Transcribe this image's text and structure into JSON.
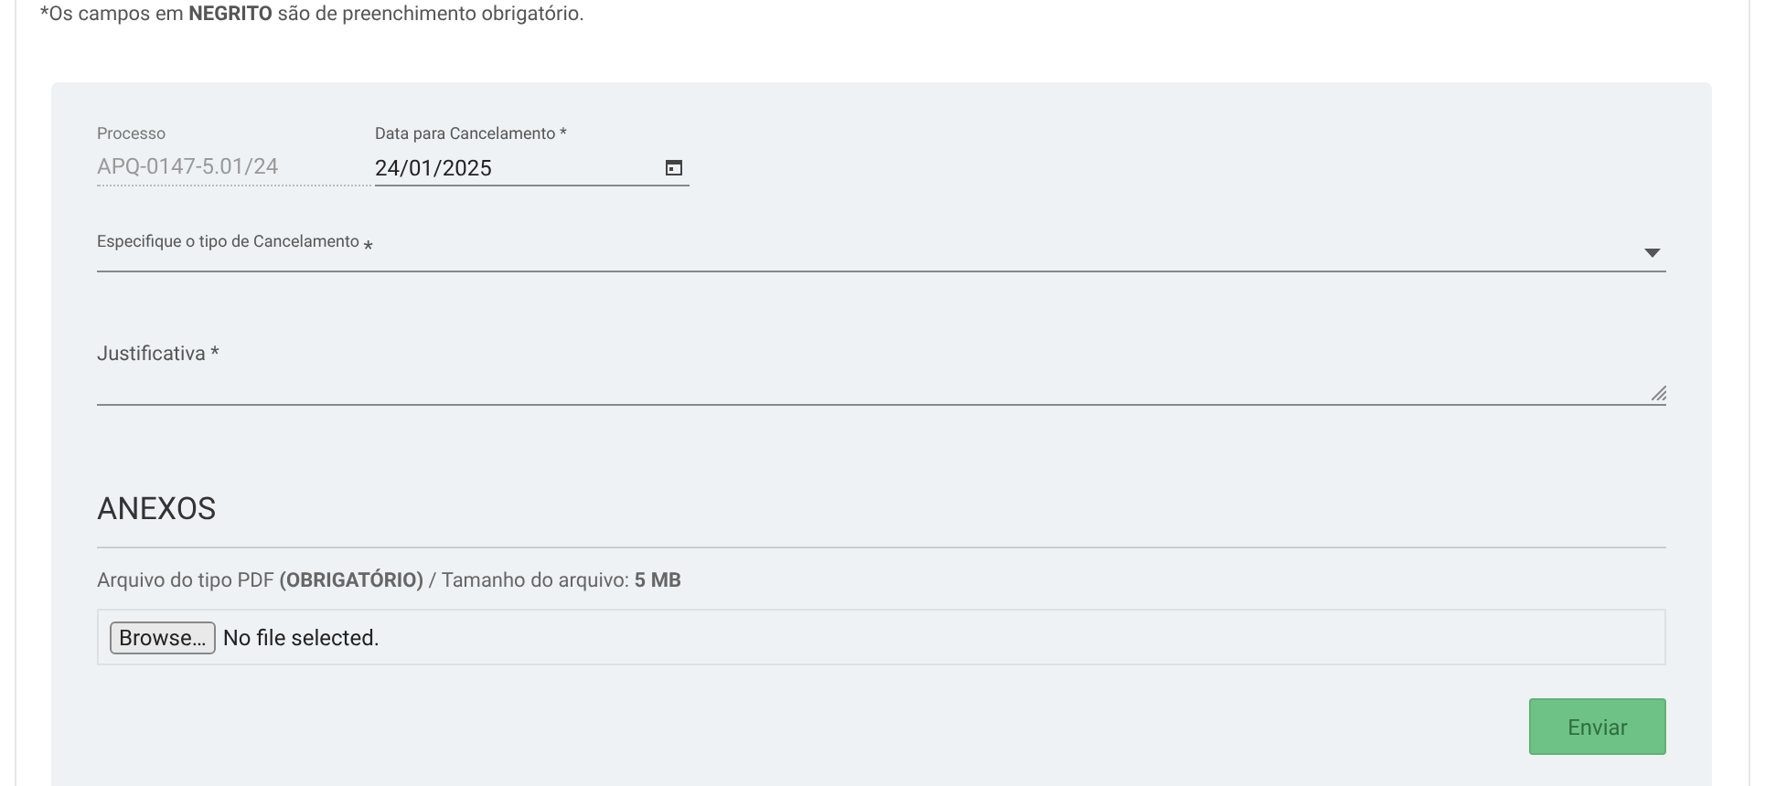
{
  "note": "*Os campos em **NEGRITO** são de preenchimento obrigatório.",
  "processo": {
    "label": "Processo",
    "value": "APQ-0147-5.01/24",
    "readonly": true
  },
  "data_cancelamento": {
    "label": "Data para Cancelamento *",
    "value": "24/01/2025"
  },
  "tipo_cancelamento": {
    "label": "Especifique o tipo de Cancelamento",
    "required_mark": "*"
  },
  "justificativa": {
    "label": "Justificativa *"
  },
  "anexos": {
    "title": "ANEXOS",
    "hint": "Arquivo do tipo PDF **(OBRIGATÓRIO)** / Tamanho do arquivo: **5 MB**",
    "browse_button": "Browse…",
    "file_status": "No file selected."
  },
  "submit": {
    "label": "Enviar",
    "disabled": true
  }
}
